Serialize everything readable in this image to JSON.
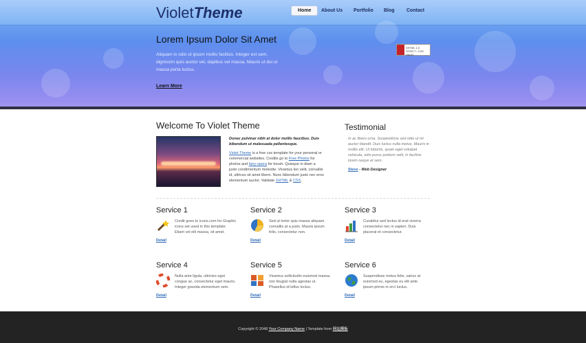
{
  "header": {
    "logo_plain": "Violet",
    "logo_bold": "Theme",
    "nav": [
      "Home",
      "About Us",
      "Portfolio",
      "Blog",
      "Contact"
    ]
  },
  "hero": {
    "title": "Lorem Ipsum Dolor Sit Amet",
    "text": "Aliquam in odio ut ipsum mollis facilisis. Integer est sem, dignissim quis auctor vel, dapibus vel massa. Mauris ut dui ut massa porta luctus.",
    "link": "Learn More",
    "badge_text": "XHTML 1.0 STRICT / CSS VALID"
  },
  "welcome": {
    "title": "Welcome To Violet Theme",
    "bold_text": "Donec pulvinar nibh at dolor mollis faucibus. Duis bibendum ut malesuada pellentesque.",
    "link_violet": "Violet Theme",
    "p1": " is a free css template for your personal or commercial websites. Credits go to ",
    "link_photos": "Free Photos",
    "p2": " for photos and ",
    "link_fairy": "fairy-opera",
    "p3": " for brush. Quisque in diam a justo condimentum molestie. Vivamus leo velit, convallis id, ultrices sit amet libero. Nunc bibendum justo nec eros elementum auctor. Validate ",
    "link_xhtml": "XHTML",
    "p4": " & ",
    "link_css": "CSS",
    "p5": "."
  },
  "testimonial": {
    "title": "Testimonial",
    "text": "In ac libero urna. Suspendisse sed odio ut mi auctor blandit. Duis luctus nulla metus. Mauris in mollis elit. Ut lobortis, quam eget volutpat vehicula, odio purus pretium velit, in facilisis lorem neque et sem.",
    "author_link": "Steve",
    "author_role": " - Web Designer"
  },
  "services": [
    {
      "title": "Service 1",
      "icon": "magic-wand-icon",
      "text": "Credit goes to icons.com for Graphic icons set used in this template. Etiam vel elit massa, sit amet.",
      "link": "Detail"
    },
    {
      "title": "Service 2",
      "icon": "pie-chart-icon",
      "text": "Sed ut tortor quis massa aliquam convallis at a justo. Mauris ipsum felis, consectetur non.",
      "link": "Detail"
    },
    {
      "title": "Service 3",
      "icon": "bar-chart-icon",
      "text": "Curabitur sed lectus id erat viverra consectetur nec in sapien. Duis placerat et consectetur.",
      "link": "Detail"
    },
    {
      "title": "Service 4",
      "icon": "lifebuoy-icon",
      "text": "Nulla ante ligula, ultricies eget congue ac, consectetur eget mauris. Integer gravida elementum sem.",
      "link": "Detail"
    },
    {
      "title": "Service 5",
      "icon": "blocks-icon",
      "text": "Vivamus sollicitudin euismod massa, non feugiat nulla agestas ut. Phasellus id tellus lectus.",
      "link": "Detail"
    },
    {
      "title": "Service 6",
      "icon": "globe-icon",
      "text": "Suspendisse metus felis, varius at euismod eu, egestas eu elit ante ipsum primis in orci luctus.",
      "link": "Detail"
    }
  ],
  "footer": {
    "prefix": "Copyright © 2048 ",
    "company": "Your Company Name",
    "middle": " | Template from ",
    "template_link": "网站模板"
  },
  "colors": {
    "header_blue": "#6aa0f0",
    "header_violet": "#a89bf2",
    "link_blue": "#2f6bb6",
    "footer_bg": "#232323"
  }
}
